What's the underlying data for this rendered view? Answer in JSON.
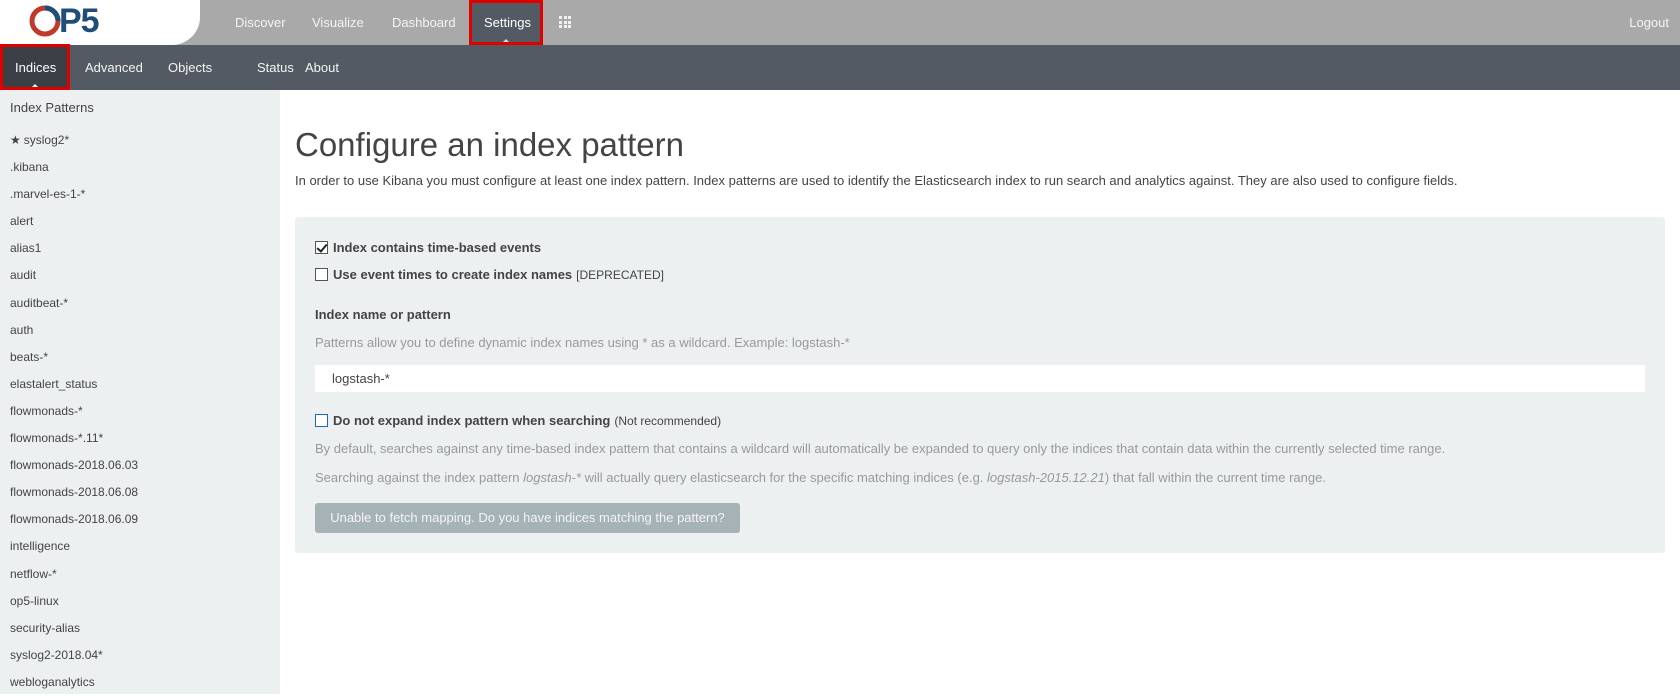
{
  "brand": {
    "logo_text": "P5",
    "logo_letter": "O"
  },
  "topnav": {
    "items": [
      {
        "label": "Discover"
      },
      {
        "label": "Visualize"
      },
      {
        "label": "Dashboard"
      },
      {
        "label": "Settings"
      }
    ],
    "logout": "Logout",
    "apps_icon": "grid-icon"
  },
  "subnav": {
    "items": [
      {
        "label": "Indices"
      },
      {
        "label": "Advanced"
      },
      {
        "label": "Objects"
      },
      {
        "label": "Status"
      },
      {
        "label": "About"
      }
    ]
  },
  "sidebar": {
    "heading": "Index Patterns",
    "items": [
      "syslog2*",
      ".kibana",
      ".marvel-es-1-*",
      "alert",
      "alias1",
      "audit",
      "auditbeat-*",
      "auth",
      "beats-*",
      "elastalert_status",
      "flowmonads-*",
      "flowmonads-*.11*",
      "flowmonads-2018.06.03",
      "flowmonads-2018.06.08",
      "flowmonads-2018.06.09",
      "intelligence",
      "netflow-*",
      "op5-linux",
      "security-alias",
      "syslog2-2018.04*",
      "webloganalytics"
    ]
  },
  "main": {
    "title": "Configure an index pattern",
    "lead": "In order to use Kibana you must configure at least one index pattern. Index patterns are used to identify the Elasticsearch index to run search and analytics against. They are also used to configure fields.",
    "time_based_label": "Index contains time-based events",
    "event_times_label": "Use event times to create index names",
    "deprecated": "[DEPRECATED]",
    "field_label": "Index name or pattern",
    "hint": "Patterns allow you to define dynamic index names using * as a wildcard. Example: logstash-*",
    "input_value": "logstash-*",
    "no_expand_label": "Do not expand index pattern when searching",
    "not_recommended": "(Not recommended)",
    "desc1": "By default, searches against any time-based index pattern that contains a wildcard will automatically be expanded to query only the indices that contain data within the currently selected time range.",
    "desc2_a": "Searching against the index pattern ",
    "desc2_b": "logstash-*",
    "desc2_c": " will actually query elasticsearch for the specific matching indices (e.g. ",
    "desc2_d": "logstash-2015.12.21",
    "desc2_e": ") that fall within the current time range.",
    "button": "Unable to fetch mapping. Do you have indices matching the pattern?"
  },
  "colors": {
    "topnav_bg": "#a9a9a9",
    "subnav_bg": "#545a63",
    "sidebar_bg": "#ecf0f1",
    "button_bg": "#a6b3b6",
    "annotation_red": "#e00000",
    "logo_blue": "#1f4e79",
    "logo_red": "#c0392b"
  }
}
